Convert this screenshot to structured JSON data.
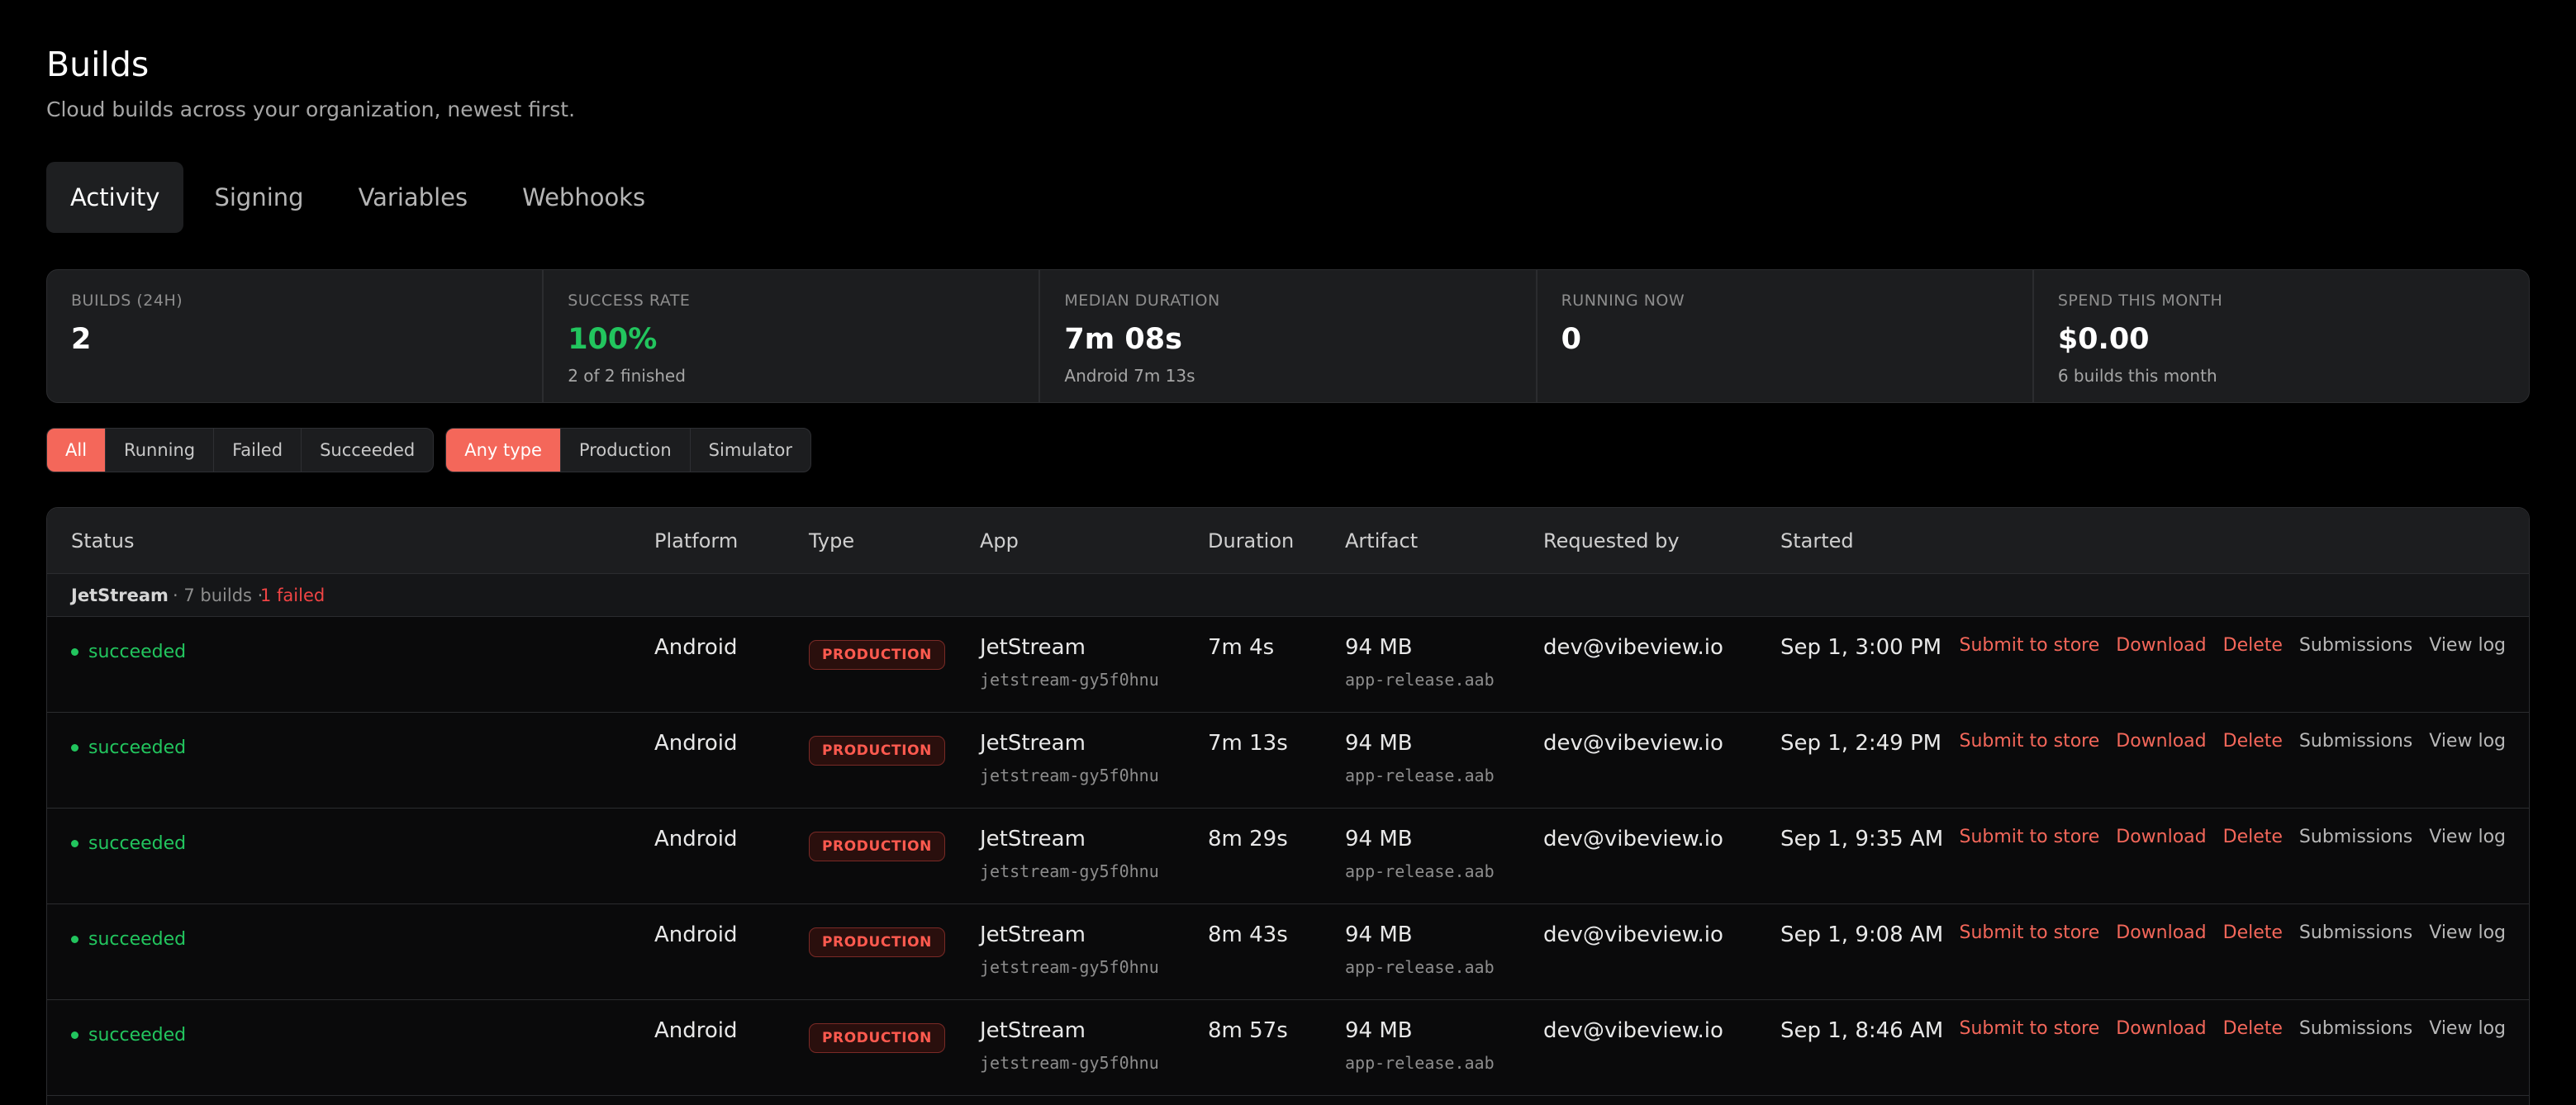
{
  "header": {
    "title": "Builds",
    "subtitle": "Cloud builds across your organization, newest first."
  },
  "tabs": [
    {
      "label": "Activity",
      "active": true
    },
    {
      "label": "Signing",
      "active": false
    },
    {
      "label": "Variables",
      "active": false
    },
    {
      "label": "Webhooks",
      "active": false
    }
  ],
  "stats": [
    {
      "label": "BUILDS (24H)",
      "value": "2",
      "sub": ""
    },
    {
      "label": "SUCCESS RATE",
      "value": "100%",
      "sub": "2 of 2 finished",
      "accent": "#22c55e"
    },
    {
      "label": "MEDIAN DURATION",
      "value": "7m 08s",
      "sub": "Android 7m 13s"
    },
    {
      "label": "RUNNING NOW",
      "value": "0",
      "sub": ""
    },
    {
      "label": "SPEND THIS MONTH",
      "value": "$0.00",
      "sub": "6 builds this month"
    }
  ],
  "filters": {
    "status": [
      {
        "label": "All",
        "active": true
      },
      {
        "label": "Running",
        "active": false
      },
      {
        "label": "Failed",
        "active": false
      },
      {
        "label": "Succeeded",
        "active": false
      }
    ],
    "type": [
      {
        "label": "Any type",
        "active": true
      },
      {
        "label": "Production",
        "active": false
      },
      {
        "label": "Simulator",
        "active": false
      }
    ]
  },
  "table": {
    "columns": [
      "Status",
      "Platform",
      "Type",
      "App",
      "Duration",
      "Artifact",
      "Requested by",
      "Started"
    ],
    "group": {
      "name": "JetStream",
      "meta": "· 7 builds ·",
      "failed": "1 failed"
    },
    "actions": {
      "submit": "Submit to store",
      "download": "Download",
      "delete": "Delete",
      "submissions": "Submissions",
      "view_log": "View log"
    },
    "rows": [
      {
        "status": "succeeded",
        "platform": "Android",
        "type": "PRODUCTION",
        "app": "JetStream",
        "app_id": "jetstream-gy5f0hnu",
        "duration": "7m 4s",
        "artifact_size": "94 MB",
        "artifact_file": "app-release.aab",
        "requested_by": "dev@vibeview.io",
        "started": "Sep 1, 3:00 PM"
      },
      {
        "status": "succeeded",
        "platform": "Android",
        "type": "PRODUCTION",
        "app": "JetStream",
        "app_id": "jetstream-gy5f0hnu",
        "duration": "7m 13s",
        "artifact_size": "94 MB",
        "artifact_file": "app-release.aab",
        "requested_by": "dev@vibeview.io",
        "started": "Sep 1, 2:49 PM"
      },
      {
        "status": "succeeded",
        "platform": "Android",
        "type": "PRODUCTION",
        "app": "JetStream",
        "app_id": "jetstream-gy5f0hnu",
        "duration": "8m 29s",
        "artifact_size": "94 MB",
        "artifact_file": "app-release.aab",
        "requested_by": "dev@vibeview.io",
        "started": "Sep 1, 9:35 AM"
      },
      {
        "status": "succeeded",
        "platform": "Android",
        "type": "PRODUCTION",
        "app": "JetStream",
        "app_id": "jetstream-gy5f0hnu",
        "duration": "8m 43s",
        "artifact_size": "94 MB",
        "artifact_file": "app-release.aab",
        "requested_by": "dev@vibeview.io",
        "started": "Sep 1, 9:08 AM"
      },
      {
        "status": "succeeded",
        "platform": "Android",
        "type": "PRODUCTION",
        "app": "JetStream",
        "app_id": "jetstream-gy5f0hnu",
        "duration": "8m 57s",
        "artifact_size": "94 MB",
        "artifact_file": "app-release.aab",
        "requested_by": "dev@vibeview.io",
        "started": "Sep 1, 8:46 AM"
      }
    ]
  },
  "colors": {
    "accent": "#f4675a",
    "success": "#22c55e",
    "danger": "#ef4444",
    "background": "#000000"
  }
}
